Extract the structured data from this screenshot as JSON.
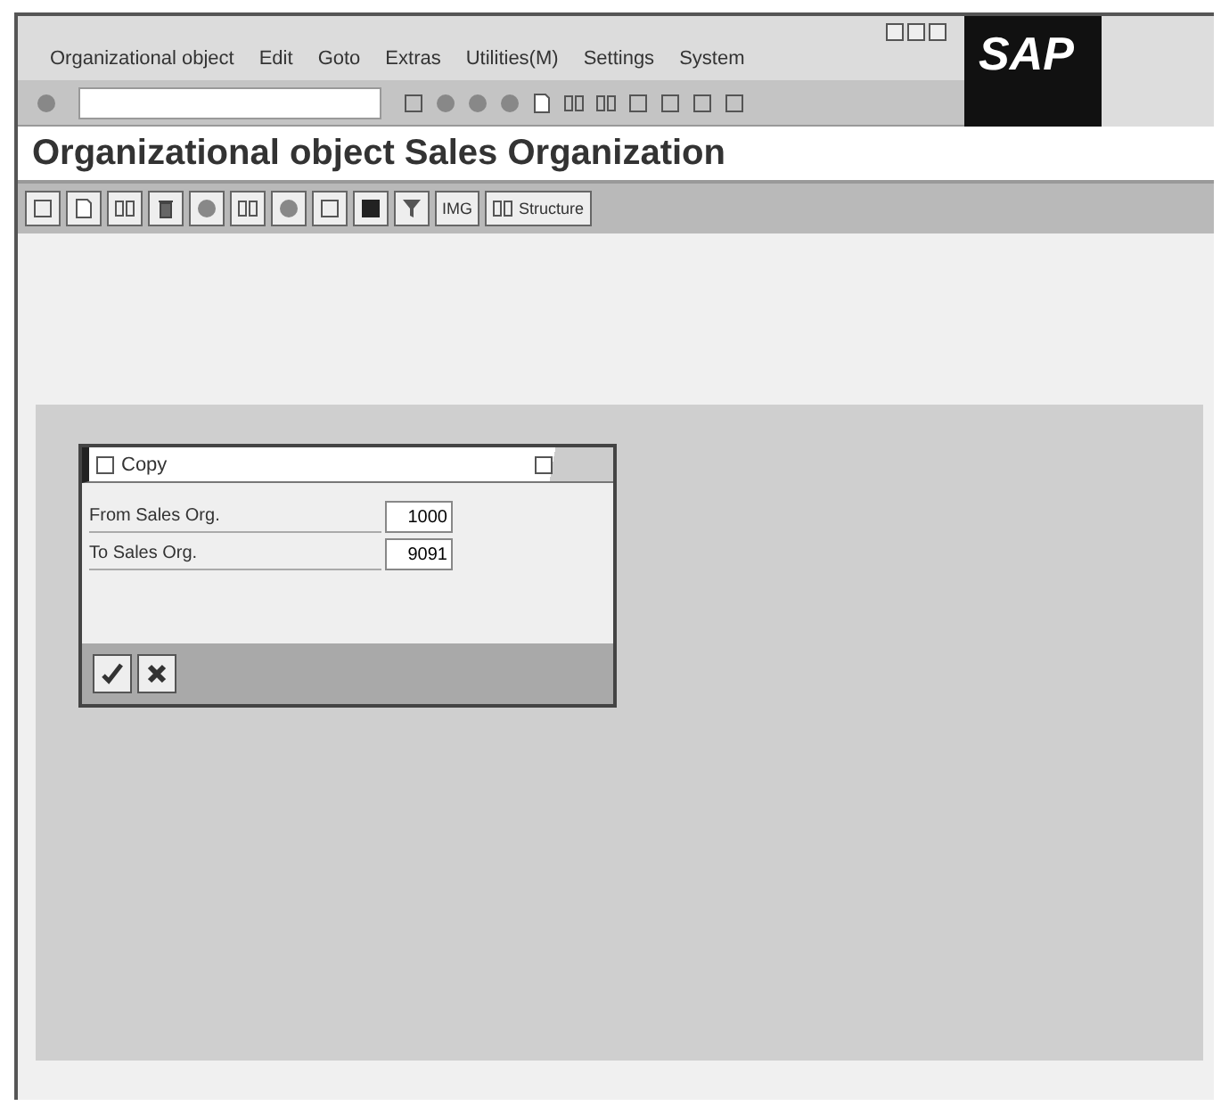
{
  "menu": [
    "Organizational object",
    "Edit",
    "Goto",
    "Extras",
    "Utilities(M)",
    "Settings",
    "System"
  ],
  "logo": "SAP",
  "title": "Organizational object Sales Organization",
  "app_toolbar": {
    "img_button": "IMG",
    "structure_button": "Structure"
  },
  "dialog": {
    "title": "Copy",
    "fields": [
      {
        "label": "From Sales Org.",
        "value": "1000"
      },
      {
        "label": "To Sales Org.",
        "value": "9091"
      }
    ]
  }
}
